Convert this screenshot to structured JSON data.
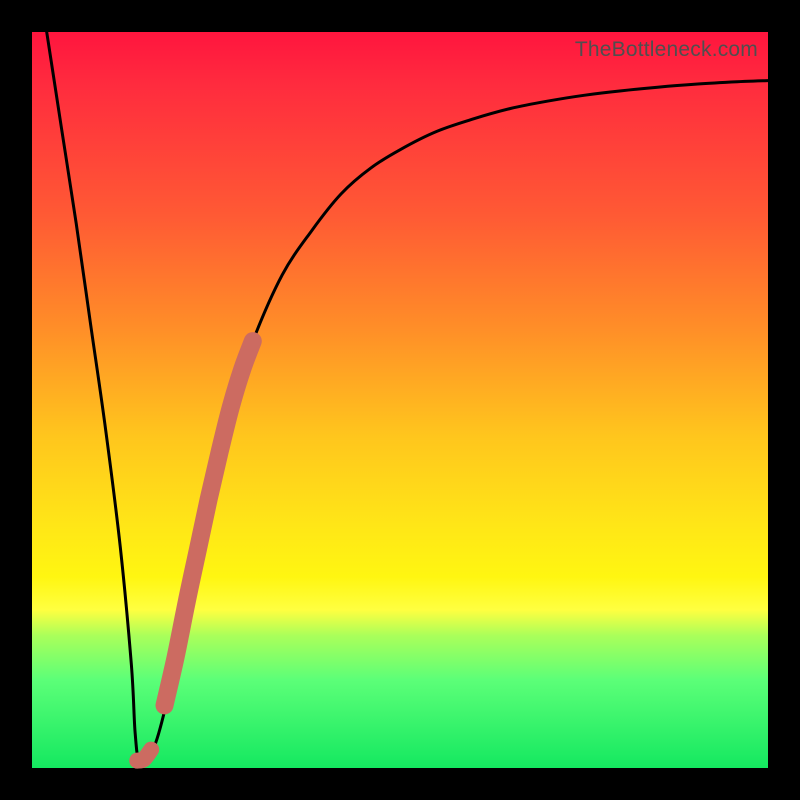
{
  "watermark": "TheBottleneck.com",
  "colors": {
    "frame": "#000000",
    "curve": "#000000",
    "highlight": "#cc6b61",
    "gradient_top": "#ff153e",
    "gradient_bottom": "#14e860"
  },
  "chart_data": {
    "type": "line",
    "title": "",
    "xlabel": "",
    "ylabel": "",
    "xlim": [
      0,
      100
    ],
    "ylim": [
      0,
      100
    ],
    "series": [
      {
        "name": "bottleneck-curve",
        "x": [
          2,
          4,
          6,
          8,
          10,
          12,
          13.5,
          14,
          14.5,
          15.5,
          17,
          19,
          21,
          23,
          25,
          27,
          30,
          34,
          38,
          42,
          46,
          50,
          55,
          60,
          65,
          70,
          75,
          80,
          85,
          90,
          95,
          100
        ],
        "y": [
          100,
          87,
          74,
          60,
          46,
          30,
          14,
          5,
          1,
          1,
          4,
          12,
          22,
          32,
          41,
          49,
          58,
          67,
          73,
          78,
          81.5,
          84,
          86.5,
          88.2,
          89.6,
          90.6,
          91.4,
          92,
          92.5,
          92.9,
          93.2,
          93.4
        ]
      },
      {
        "name": "highlight-segment-lower",
        "x": [
          14.3,
          15.2,
          16.2
        ],
        "y": [
          1.0,
          1.2,
          2.5
        ]
      },
      {
        "name": "highlight-segment-upper",
        "x": [
          18.0,
          19.5,
          21.0,
          22.5,
          24.0,
          25.5,
          27.0,
          28.5,
          30.0
        ],
        "y": [
          8.5,
          15.0,
          22.5,
          29.5,
          36.5,
          43.0,
          49.0,
          54.0,
          58.0
        ]
      }
    ],
    "annotations": []
  }
}
